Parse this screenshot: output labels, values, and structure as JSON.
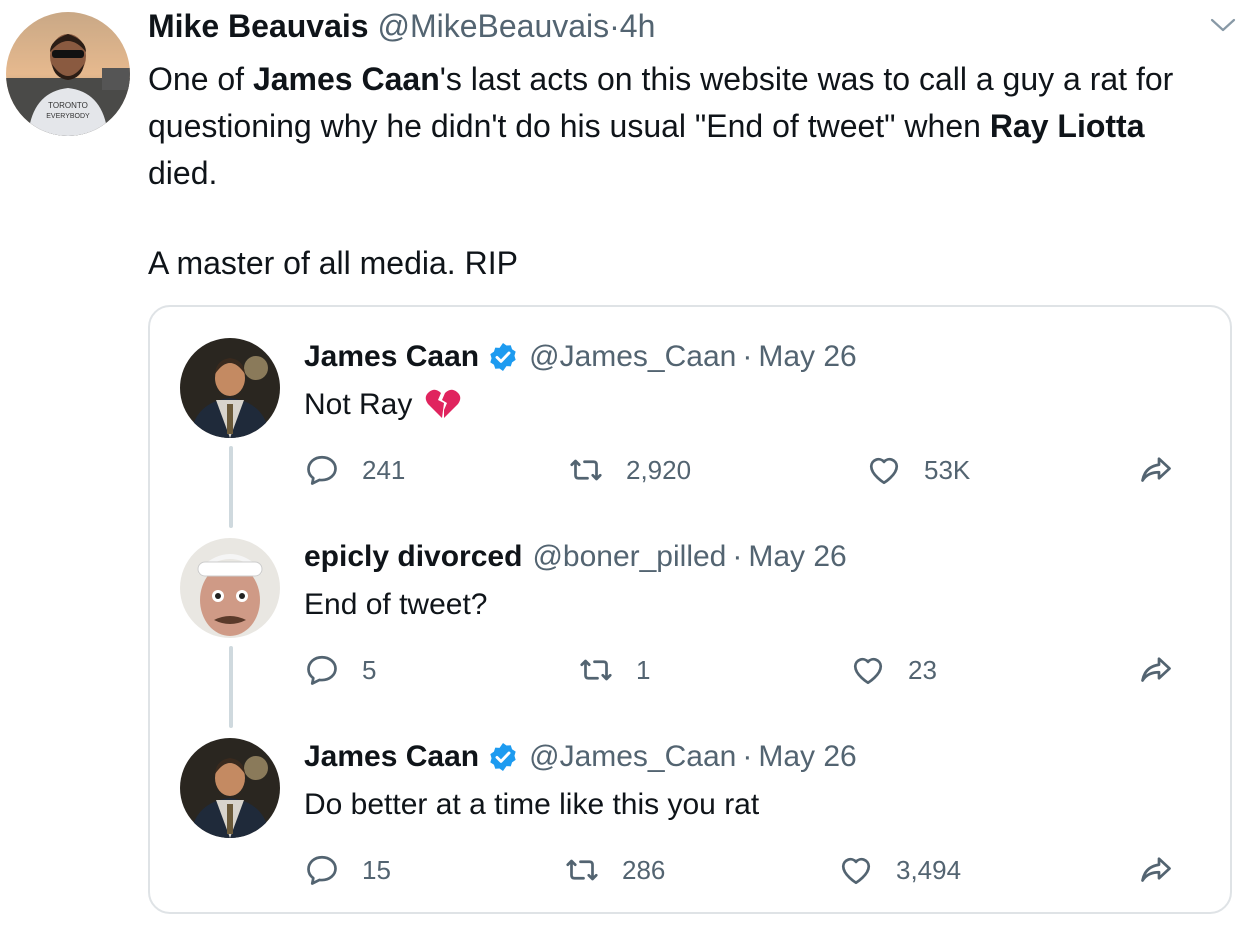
{
  "main_tweet": {
    "author_name": "Mike Beauvais",
    "handle": "@MikeBeauvais",
    "separator": "·",
    "time": "4h",
    "avatar_shirt_text": "TORONTO VS EVERYBODY",
    "body": [
      {
        "text": "One of ",
        "bold": false
      },
      {
        "text": "James Caan",
        "bold": true
      },
      {
        "text": "'s last acts on this website was to call a guy a rat for questioning why he didn't do his usual \"End of tweet\" when ",
        "bold": false
      },
      {
        "text": "Ray Liotta",
        "bold": true
      },
      {
        "text": " died.",
        "bold": false
      }
    ],
    "body_line2": "A master of all media. RIP"
  },
  "quoted_thread": [
    {
      "author_name": "James Caan",
      "verified": true,
      "handle": "@James_Caan",
      "separator": "·",
      "date": "May 26",
      "text": "Not Ray",
      "emoji": "broken-heart",
      "replies": "241",
      "retweets": "2,920",
      "likes": "53K"
    },
    {
      "author_name": "epicly divorced",
      "verified": false,
      "handle": "@boner_pilled",
      "separator": "·",
      "date": "May 26",
      "text": "End of tweet?",
      "replies": "5",
      "retweets": "1",
      "likes": "23"
    },
    {
      "author_name": "James Caan",
      "verified": true,
      "handle": "@James_Caan",
      "separator": "·",
      "date": "May 26",
      "text": "Do better at a time like this you rat",
      "replies": "15",
      "retweets": "286",
      "likes": "3,494"
    }
  ],
  "colors": {
    "text": "#0f1419",
    "secondary": "#536471",
    "verified_blue": "#1d9bf0",
    "border": "#dfe3e6",
    "broken_heart": "#e0245e"
  },
  "icons": [
    "reply-icon",
    "retweet-icon",
    "like-icon",
    "share-icon",
    "verified-badge-icon",
    "chevron-down-icon",
    "broken-heart-icon"
  ]
}
